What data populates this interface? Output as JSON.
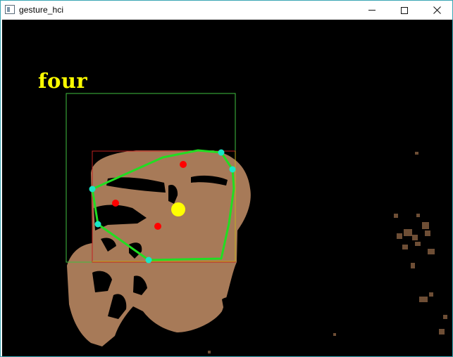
{
  "window": {
    "title": "gesture_hci",
    "border_color": "#3aa6b4"
  },
  "icons": {
    "app": "app-window-icon",
    "minimize": "minimize-icon",
    "maximize": "maximize-icon",
    "close": "close-icon"
  },
  "detection": {
    "gesture_label": "four",
    "label_color": "#ffff00",
    "bounding_box_color": "#3fbf3f",
    "hand_box_color": "#c02020",
    "hull_color": "#22dd22",
    "hull_points_color": "#19e6c8",
    "defect_points_color": "#ff0000",
    "center_color": "#ffff00"
  }
}
